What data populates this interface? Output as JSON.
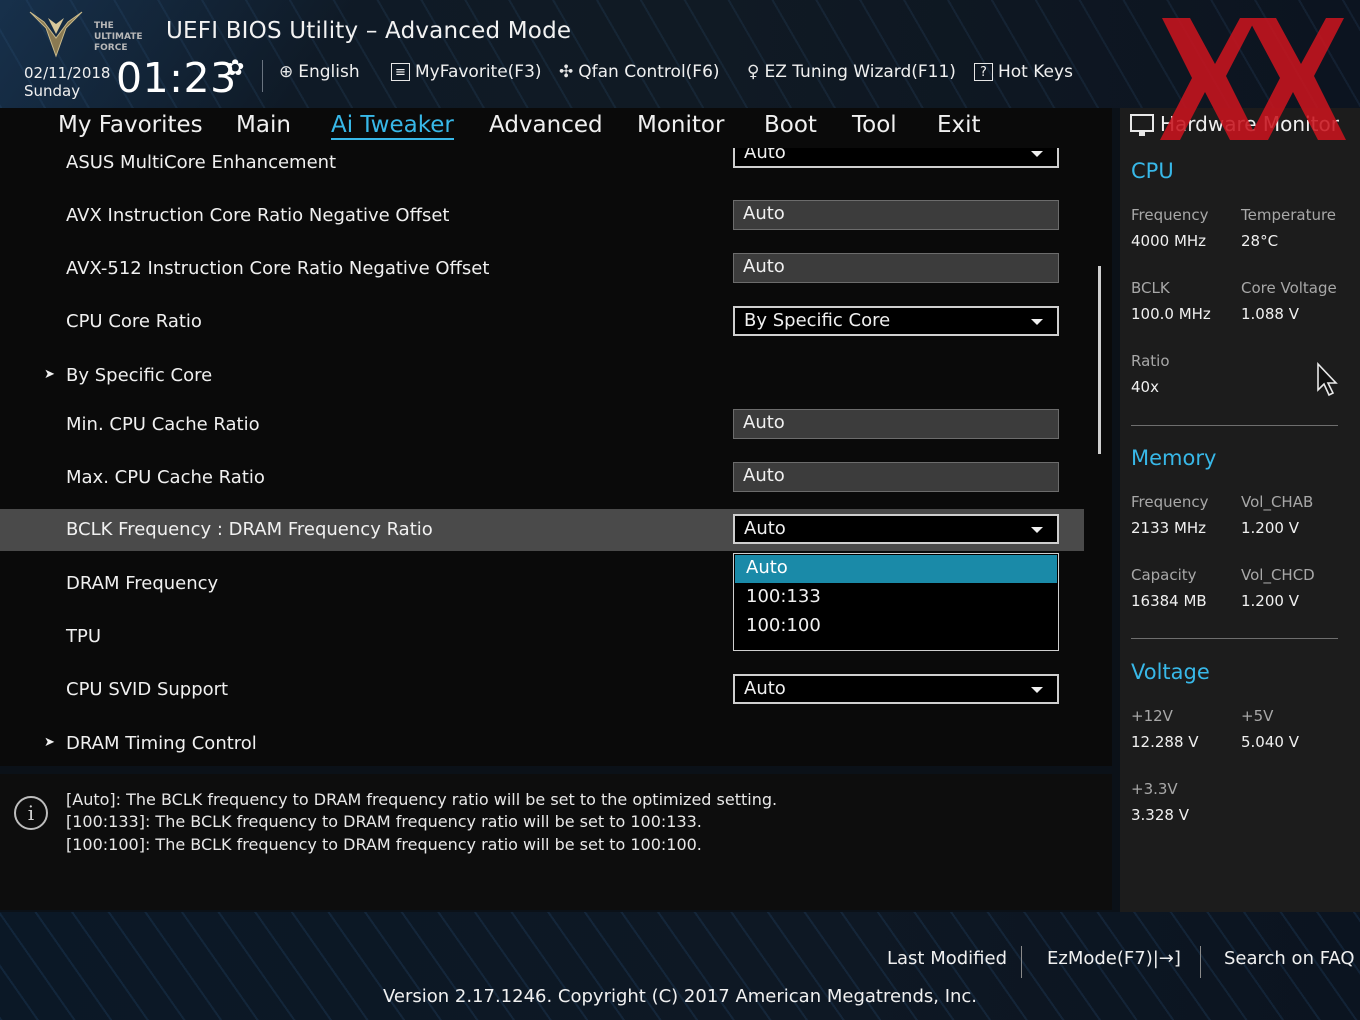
{
  "header": {
    "title": "UEFI BIOS Utility – Advanced Mode",
    "date": "02/11/2018",
    "day": "Sunday",
    "time": "01:23",
    "toolbar": {
      "language": "English",
      "favorite": "MyFavorite(F3)",
      "qfan": "Qfan Control(F6)",
      "ez_tuning": "EZ Tuning Wizard(F11)",
      "hotkeys": "Hot Keys"
    },
    "logo_text": [
      "THE",
      "ULTIMATE",
      "FORCE"
    ]
  },
  "menu": {
    "items": [
      "My Favorites",
      "Main",
      "Ai Tweaker",
      "Advanced",
      "Monitor",
      "Boot",
      "Tool",
      "Exit"
    ],
    "active": "Ai Tweaker"
  },
  "settings": {
    "rows": [
      {
        "label": "ASUS MultiCore Enhancement",
        "value": "Auto",
        "kind": "dropdown"
      },
      {
        "label": "AVX Instruction Core Ratio Negative Offset",
        "value": "Auto",
        "kind": "readonly"
      },
      {
        "label": "AVX-512 Instruction Core Ratio Negative Offset",
        "value": "Auto",
        "kind": "readonly"
      },
      {
        "label": "CPU Core Ratio",
        "value": "By Specific Core",
        "kind": "dropdown"
      },
      {
        "label": "By Specific Core",
        "kind": "submenu"
      },
      {
        "label": "Min. CPU Cache Ratio",
        "value": "Auto",
        "kind": "readonly"
      },
      {
        "label": "Max. CPU Cache Ratio",
        "value": "Auto",
        "kind": "readonly"
      },
      {
        "label": "BCLK Frequency : DRAM Frequency Ratio",
        "value": "Auto",
        "kind": "dropdown",
        "selected": true
      },
      {
        "label": "DRAM Frequency",
        "kind": "plain"
      },
      {
        "label": "TPU",
        "kind": "plain"
      },
      {
        "label": "CPU SVID Support",
        "value": "Auto",
        "kind": "dropdown"
      },
      {
        "label": "DRAM Timing Control",
        "kind": "submenu"
      }
    ],
    "open_dropdown": {
      "options": [
        "Auto",
        "100:133",
        "100:100"
      ],
      "highlighted": "Auto"
    }
  },
  "help": {
    "lines": [
      "[Auto]: The BCLK frequency to DRAM frequency ratio will be set to the optimized setting.",
      "[100:133]: The BCLK frequency to DRAM frequency ratio will be set to 100:133.",
      "[100:100]: The BCLK frequency to DRAM frequency ratio will be set to 100:100."
    ]
  },
  "hardware_monitor": {
    "title": "Hardware Monitor",
    "cpu": {
      "heading": "CPU",
      "frequency_label": "Frequency",
      "frequency": "4000 MHz",
      "temperature_label": "Temperature",
      "temperature": "28°C",
      "bclk_label": "BCLK",
      "bclk": "100.0 MHz",
      "core_voltage_label": "Core Voltage",
      "core_voltage": "1.088 V",
      "ratio_label": "Ratio",
      "ratio": "40x"
    },
    "memory": {
      "heading": "Memory",
      "frequency_label": "Frequency",
      "frequency": "2133 MHz",
      "vol_chab_label": "Vol_CHAB",
      "vol_chab": "1.200 V",
      "capacity_label": "Capacity",
      "capacity": "16384 MB",
      "vol_chcd_label": "Vol_CHCD",
      "vol_chcd": "1.200 V"
    },
    "voltage": {
      "heading": "Voltage",
      "v12_label": "+12V",
      "v12": "12.288 V",
      "v5_label": "+5V",
      "v5": "5.040 V",
      "v33_label": "+3.3V",
      "v33": "3.328 V"
    }
  },
  "footer": {
    "last_modified": "Last Modified",
    "ezmode": "EzMode(F7)|",
    "faq": "Search on FAQ",
    "version": "Version 2.17.1246. Copyright (C) 2017 American Megatrends, Inc."
  },
  "colors": {
    "accent": "#38b8e8",
    "selection": "#1a8aa8",
    "watermark": "#c8141e"
  }
}
